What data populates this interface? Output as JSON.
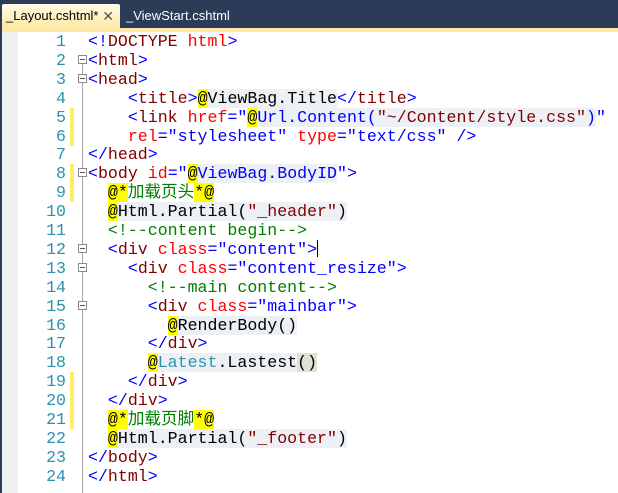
{
  "tabs": [
    {
      "label": "_Layout.cshtml*",
      "active": true
    },
    {
      "label": "_ViewStart.cshtml",
      "active": false
    }
  ],
  "close_glyph": "✕",
  "colors": {
    "tag": "#0000ff",
    "element": "#800000",
    "attribute": "#ff0000",
    "comment": "#008000",
    "razor_at": "#ffff00",
    "line_number": "#2b91af"
  },
  "lines": [
    {
      "n": "1",
      "tokens": [
        [
          "b",
          "<!"
        ],
        [
          "m",
          "DOCTYPE"
        ],
        [
          "r",
          " html"
        ],
        [
          "b",
          ">"
        ]
      ]
    },
    {
      "n": "2",
      "fold": true,
      "tokens": [
        [
          "b",
          "<"
        ],
        [
          "m",
          "html"
        ],
        [
          "b",
          ">"
        ]
      ]
    },
    {
      "n": "3",
      "fold": true,
      "tokens": [
        [
          "b",
          "<"
        ],
        [
          "m",
          "head"
        ],
        [
          "b",
          ">"
        ]
      ]
    },
    {
      "n": "4",
      "tokens": [
        [
          "k",
          "    "
        ],
        [
          "b",
          "<"
        ],
        [
          "m",
          "title"
        ],
        [
          "b",
          ">"
        ],
        [
          "at",
          "@"
        ],
        [
          "k rz",
          "ViewBag.Title"
        ],
        [
          "b",
          "</"
        ],
        [
          "m",
          "title"
        ],
        [
          "b",
          ">"
        ]
      ]
    },
    {
      "n": "5",
      "chg": true,
      "tokens": [
        [
          "k",
          "    "
        ],
        [
          "b",
          "<"
        ],
        [
          "m",
          "link"
        ],
        [
          "r",
          " href"
        ],
        [
          "b",
          "=\""
        ],
        [
          "at",
          "@"
        ],
        [
          "b rz",
          "Url.Content("
        ],
        [
          "m rz",
          "\"~/Content/style.css\""
        ],
        [
          "b rz",
          ")"
        ],
        [
          "b",
          "\""
        ]
      ]
    },
    {
      "n": "6",
      "chg": true,
      "tokens": [
        [
          "k",
          "    "
        ],
        [
          "r",
          "rel"
        ],
        [
          "b",
          "=\"stylesheet\""
        ],
        [
          "r",
          " type"
        ],
        [
          "b",
          "=\"text/css\""
        ],
        [
          "b",
          " />"
        ]
      ]
    },
    {
      "n": "7",
      "tokens": [
        [
          "b",
          "</"
        ],
        [
          "m",
          "head"
        ],
        [
          "b",
          ">"
        ]
      ]
    },
    {
      "n": "8",
      "chg": true,
      "fold": true,
      "tokens": [
        [
          "b",
          "<"
        ],
        [
          "m",
          "body"
        ],
        [
          "r",
          " id"
        ],
        [
          "b",
          "=\""
        ],
        [
          "at",
          "@"
        ],
        [
          "b rz",
          "ViewBag.BodyID"
        ],
        [
          "b",
          "\">"
        ]
      ]
    },
    {
      "n": "9",
      "chg": true,
      "tokens": [
        [
          "k",
          "  "
        ],
        [
          "at",
          "@*"
        ],
        [
          "g",
          "加载页头"
        ],
        [
          "at",
          "*@"
        ]
      ]
    },
    {
      "n": "10",
      "tokens": [
        [
          "k",
          "  "
        ],
        [
          "at",
          "@"
        ],
        [
          "k rz",
          "Html.Partial("
        ],
        [
          "m rz",
          "\"_header\""
        ],
        [
          "k rz",
          ")"
        ]
      ]
    },
    {
      "n": "11",
      "tokens": [
        [
          "k",
          "  "
        ],
        [
          "g",
          "<!--content begin-->"
        ]
      ]
    },
    {
      "n": "12",
      "fold": true,
      "cursor": true,
      "tokens": [
        [
          "k",
          "  "
        ],
        [
          "b",
          "<"
        ],
        [
          "m",
          "div"
        ],
        [
          "r",
          " class"
        ],
        [
          "b",
          "=\"content\">"
        ]
      ]
    },
    {
      "n": "13",
      "fold": true,
      "tokens": [
        [
          "k",
          "    "
        ],
        [
          "b",
          "<"
        ],
        [
          "m",
          "div"
        ],
        [
          "r",
          " class"
        ],
        [
          "b",
          "=\"content_resize\">"
        ]
      ]
    },
    {
      "n": "14",
      "tokens": [
        [
          "k",
          "      "
        ],
        [
          "g",
          "<!--main content-->"
        ]
      ]
    },
    {
      "n": "15",
      "fold": true,
      "tokens": [
        [
          "k",
          "      "
        ],
        [
          "b",
          "<"
        ],
        [
          "m",
          "div"
        ],
        [
          "r",
          " class"
        ],
        [
          "b",
          "=\"mainbar\">"
        ]
      ]
    },
    {
      "n": "16",
      "tokens": [
        [
          "k",
          "        "
        ],
        [
          "at",
          "@"
        ],
        [
          "k rz",
          "RenderBody()"
        ]
      ]
    },
    {
      "n": "17",
      "tokens": [
        [
          "k",
          "      "
        ],
        [
          "b",
          "</"
        ],
        [
          "m",
          "div"
        ],
        [
          "b",
          ">"
        ]
      ]
    },
    {
      "n": "18",
      "tokens": [
        [
          "k",
          "      "
        ],
        [
          "at",
          "@"
        ],
        [
          "t rz",
          "Latest"
        ],
        [
          "k rz",
          ".Lastest"
        ],
        [
          "k rzd",
          "()"
        ]
      ]
    },
    {
      "n": "19",
      "chg": true,
      "tokens": [
        [
          "k",
          "    "
        ],
        [
          "b",
          "</"
        ],
        [
          "m",
          "div"
        ],
        [
          "b",
          ">"
        ]
      ]
    },
    {
      "n": "20",
      "chg": true,
      "tokens": [
        [
          "k",
          "  "
        ],
        [
          "b",
          "</"
        ],
        [
          "m",
          "div"
        ],
        [
          "b",
          ">"
        ]
      ]
    },
    {
      "n": "21",
      "chg": true,
      "tokens": [
        [
          "k",
          "  "
        ],
        [
          "at",
          "@*"
        ],
        [
          "g",
          "加载页脚"
        ],
        [
          "at",
          "*@"
        ]
      ]
    },
    {
      "n": "22",
      "tokens": [
        [
          "k",
          "  "
        ],
        [
          "at",
          "@"
        ],
        [
          "k rz",
          "Html.Partial("
        ],
        [
          "m rz",
          "\"_footer\""
        ],
        [
          "k rz",
          ")"
        ]
      ]
    },
    {
      "n": "23",
      "tokens": [
        [
          "b",
          "</"
        ],
        [
          "m",
          "body"
        ],
        [
          "b",
          ">"
        ]
      ]
    },
    {
      "n": "24",
      "tokens": [
        [
          "b",
          "</"
        ],
        [
          "m",
          "html"
        ],
        [
          "b",
          ">"
        ]
      ]
    }
  ]
}
